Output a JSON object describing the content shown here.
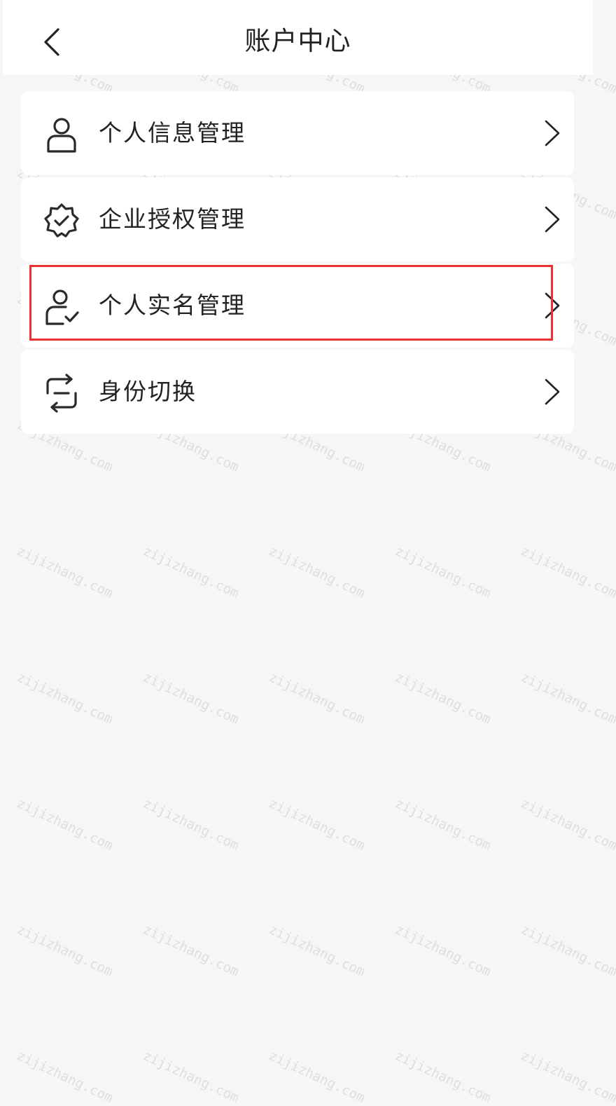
{
  "header": {
    "title": "账户中心",
    "back_icon": "chevron-left-icon"
  },
  "menu": [
    {
      "label": "个人信息管理",
      "icon": "person-icon"
    },
    {
      "label": "企业授权管理",
      "icon": "verified-badge-icon"
    },
    {
      "label": "个人实名管理",
      "icon": "person-verified-icon"
    },
    {
      "label": "身份切换",
      "icon": "switch-arrows-icon"
    }
  ],
  "highlight": {
    "color": "#e8302e",
    "target_label": "个人实名管理"
  },
  "watermark": {
    "text": "zijizhang.com"
  },
  "colors": {
    "background": "#f5f6f8",
    "card": "#ffffff",
    "text": "#222222"
  }
}
